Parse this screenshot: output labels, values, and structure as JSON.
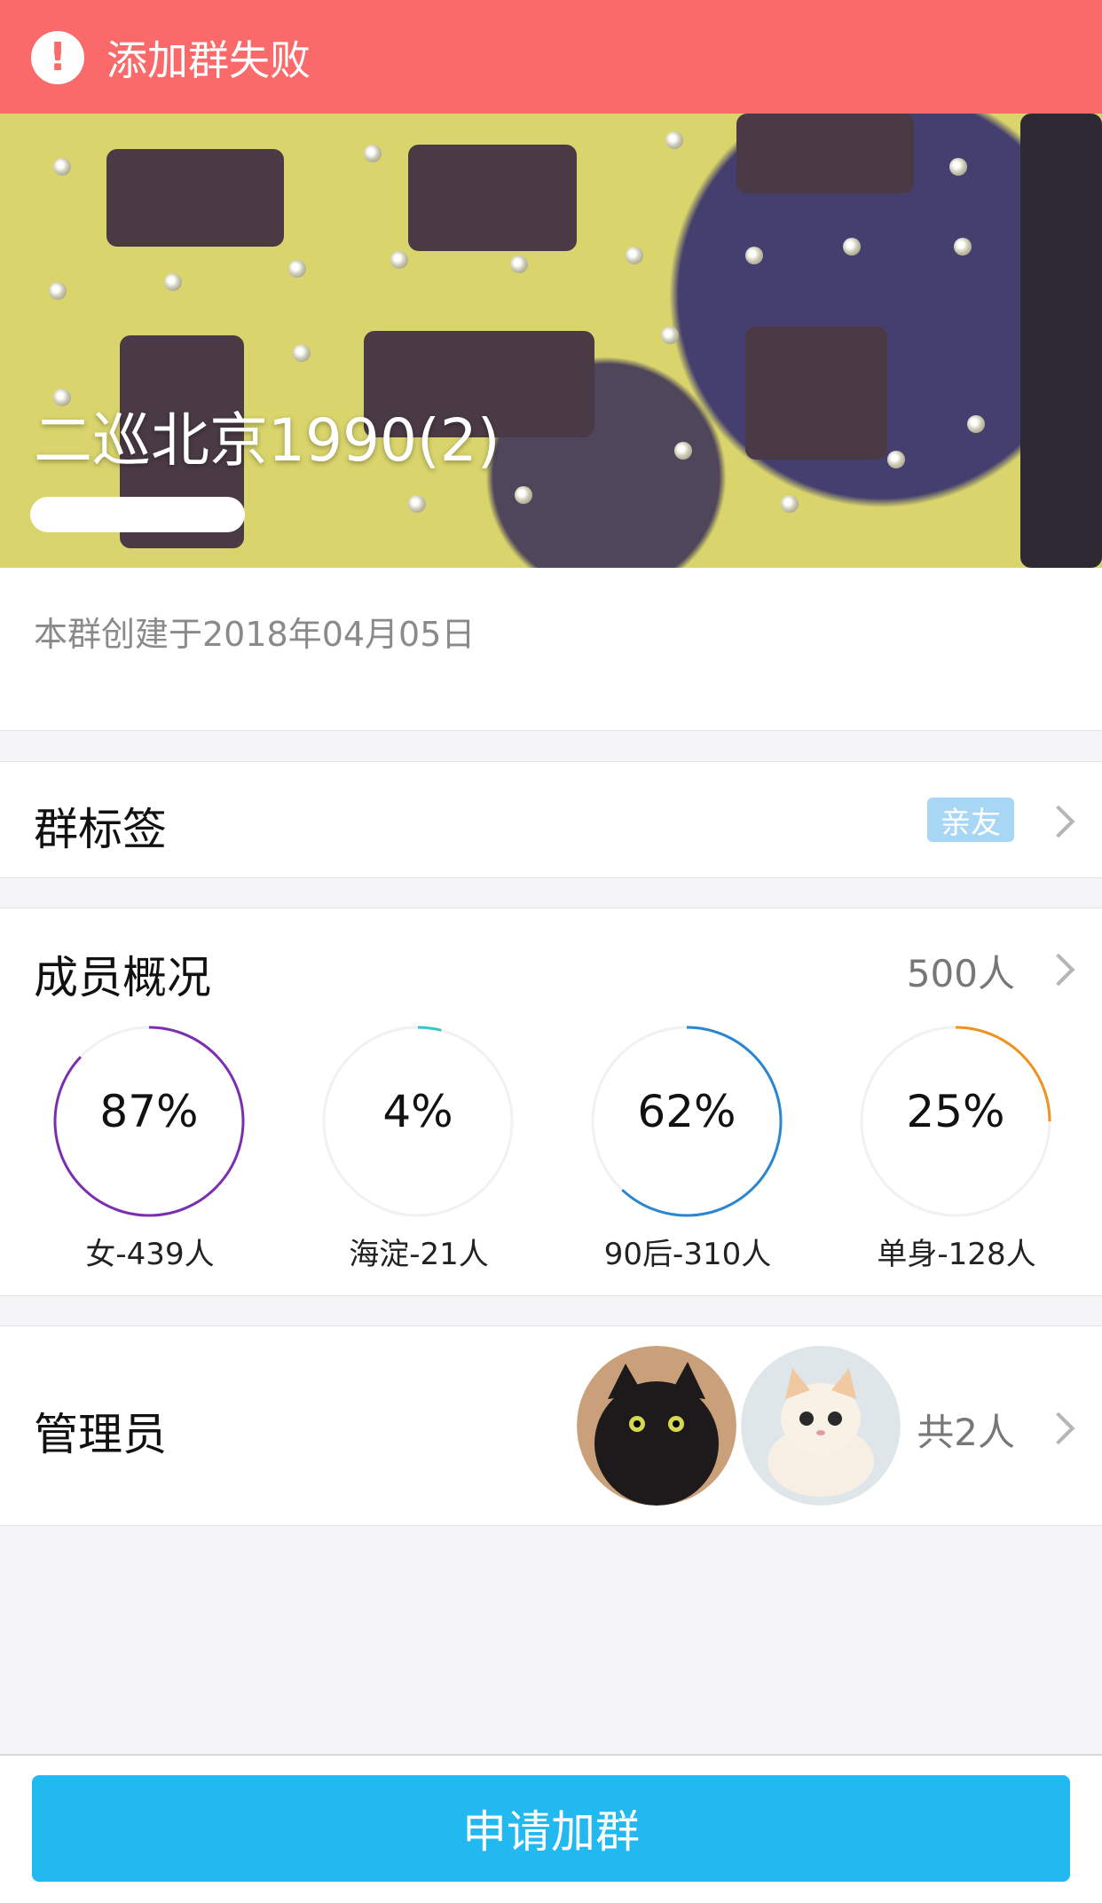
{
  "toast": {
    "icon": "alert-icon",
    "message": "添加群失败",
    "background_color": "#fa6a6a"
  },
  "group": {
    "name": "二巡北京1990(2)",
    "created_text": "本群创建于2018年04月05日"
  },
  "tags": {
    "label": "群标签",
    "badge": "亲友"
  },
  "members": {
    "label": "成员概况",
    "count": "500人",
    "stats": [
      {
        "value_label": "87%",
        "caption": "女-439人",
        "percent": 87,
        "color": "#7b2fb0"
      },
      {
        "value_label": "4%",
        "caption": "海淀-21人",
        "percent": 4,
        "color": "#36c7c0"
      },
      {
        "value_label": "62%",
        "caption": "90后-310人",
        "percent": 62,
        "color": "#2a86d0"
      },
      {
        "value_label": "25%",
        "caption": "单身-128人",
        "percent": 25,
        "color": "#f0921e"
      }
    ]
  },
  "admins": {
    "label": "管理员",
    "count": "共2人",
    "avatars": [
      "black-cat-avatar",
      "white-kitten-avatar"
    ]
  },
  "apply_button": {
    "label": "申请加群",
    "color": "#22b8f0"
  }
}
